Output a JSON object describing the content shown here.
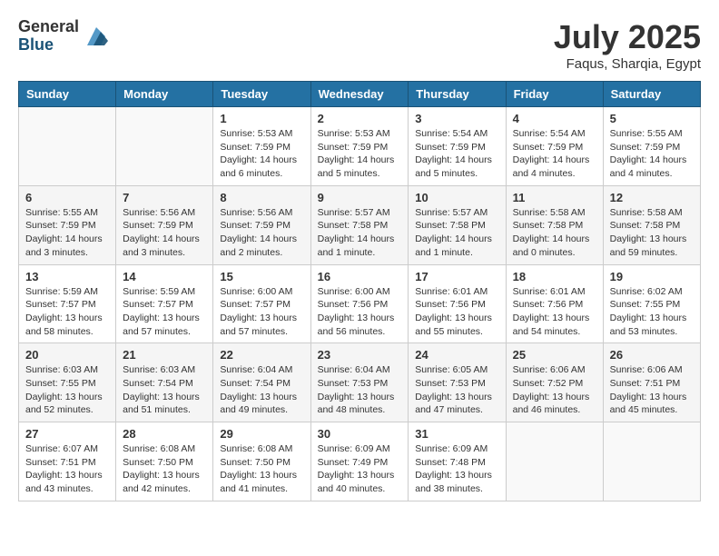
{
  "header": {
    "logo_general": "General",
    "logo_blue": "Blue",
    "month_title": "July 2025",
    "location": "Faqus, Sharqia, Egypt"
  },
  "days_of_week": [
    "Sunday",
    "Monday",
    "Tuesday",
    "Wednesday",
    "Thursday",
    "Friday",
    "Saturday"
  ],
  "weeks": [
    [
      {
        "day": "",
        "detail": ""
      },
      {
        "day": "",
        "detail": ""
      },
      {
        "day": "1",
        "detail": "Sunrise: 5:53 AM\nSunset: 7:59 PM\nDaylight: 14 hours and 6 minutes."
      },
      {
        "day": "2",
        "detail": "Sunrise: 5:53 AM\nSunset: 7:59 PM\nDaylight: 14 hours and 5 minutes."
      },
      {
        "day": "3",
        "detail": "Sunrise: 5:54 AM\nSunset: 7:59 PM\nDaylight: 14 hours and 5 minutes."
      },
      {
        "day": "4",
        "detail": "Sunrise: 5:54 AM\nSunset: 7:59 PM\nDaylight: 14 hours and 4 minutes."
      },
      {
        "day": "5",
        "detail": "Sunrise: 5:55 AM\nSunset: 7:59 PM\nDaylight: 14 hours and 4 minutes."
      }
    ],
    [
      {
        "day": "6",
        "detail": "Sunrise: 5:55 AM\nSunset: 7:59 PM\nDaylight: 14 hours and 3 minutes."
      },
      {
        "day": "7",
        "detail": "Sunrise: 5:56 AM\nSunset: 7:59 PM\nDaylight: 14 hours and 3 minutes."
      },
      {
        "day": "8",
        "detail": "Sunrise: 5:56 AM\nSunset: 7:59 PM\nDaylight: 14 hours and 2 minutes."
      },
      {
        "day": "9",
        "detail": "Sunrise: 5:57 AM\nSunset: 7:58 PM\nDaylight: 14 hours and 1 minute."
      },
      {
        "day": "10",
        "detail": "Sunrise: 5:57 AM\nSunset: 7:58 PM\nDaylight: 14 hours and 1 minute."
      },
      {
        "day": "11",
        "detail": "Sunrise: 5:58 AM\nSunset: 7:58 PM\nDaylight: 14 hours and 0 minutes."
      },
      {
        "day": "12",
        "detail": "Sunrise: 5:58 AM\nSunset: 7:58 PM\nDaylight: 13 hours and 59 minutes."
      }
    ],
    [
      {
        "day": "13",
        "detail": "Sunrise: 5:59 AM\nSunset: 7:57 PM\nDaylight: 13 hours and 58 minutes."
      },
      {
        "day": "14",
        "detail": "Sunrise: 5:59 AM\nSunset: 7:57 PM\nDaylight: 13 hours and 57 minutes."
      },
      {
        "day": "15",
        "detail": "Sunrise: 6:00 AM\nSunset: 7:57 PM\nDaylight: 13 hours and 57 minutes."
      },
      {
        "day": "16",
        "detail": "Sunrise: 6:00 AM\nSunset: 7:56 PM\nDaylight: 13 hours and 56 minutes."
      },
      {
        "day": "17",
        "detail": "Sunrise: 6:01 AM\nSunset: 7:56 PM\nDaylight: 13 hours and 55 minutes."
      },
      {
        "day": "18",
        "detail": "Sunrise: 6:01 AM\nSunset: 7:56 PM\nDaylight: 13 hours and 54 minutes."
      },
      {
        "day": "19",
        "detail": "Sunrise: 6:02 AM\nSunset: 7:55 PM\nDaylight: 13 hours and 53 minutes."
      }
    ],
    [
      {
        "day": "20",
        "detail": "Sunrise: 6:03 AM\nSunset: 7:55 PM\nDaylight: 13 hours and 52 minutes."
      },
      {
        "day": "21",
        "detail": "Sunrise: 6:03 AM\nSunset: 7:54 PM\nDaylight: 13 hours and 51 minutes."
      },
      {
        "day": "22",
        "detail": "Sunrise: 6:04 AM\nSunset: 7:54 PM\nDaylight: 13 hours and 49 minutes."
      },
      {
        "day": "23",
        "detail": "Sunrise: 6:04 AM\nSunset: 7:53 PM\nDaylight: 13 hours and 48 minutes."
      },
      {
        "day": "24",
        "detail": "Sunrise: 6:05 AM\nSunset: 7:53 PM\nDaylight: 13 hours and 47 minutes."
      },
      {
        "day": "25",
        "detail": "Sunrise: 6:06 AM\nSunset: 7:52 PM\nDaylight: 13 hours and 46 minutes."
      },
      {
        "day": "26",
        "detail": "Sunrise: 6:06 AM\nSunset: 7:51 PM\nDaylight: 13 hours and 45 minutes."
      }
    ],
    [
      {
        "day": "27",
        "detail": "Sunrise: 6:07 AM\nSunset: 7:51 PM\nDaylight: 13 hours and 43 minutes."
      },
      {
        "day": "28",
        "detail": "Sunrise: 6:08 AM\nSunset: 7:50 PM\nDaylight: 13 hours and 42 minutes."
      },
      {
        "day": "29",
        "detail": "Sunrise: 6:08 AM\nSunset: 7:50 PM\nDaylight: 13 hours and 41 minutes."
      },
      {
        "day": "30",
        "detail": "Sunrise: 6:09 AM\nSunset: 7:49 PM\nDaylight: 13 hours and 40 minutes."
      },
      {
        "day": "31",
        "detail": "Sunrise: 6:09 AM\nSunset: 7:48 PM\nDaylight: 13 hours and 38 minutes."
      },
      {
        "day": "",
        "detail": ""
      },
      {
        "day": "",
        "detail": ""
      }
    ]
  ]
}
